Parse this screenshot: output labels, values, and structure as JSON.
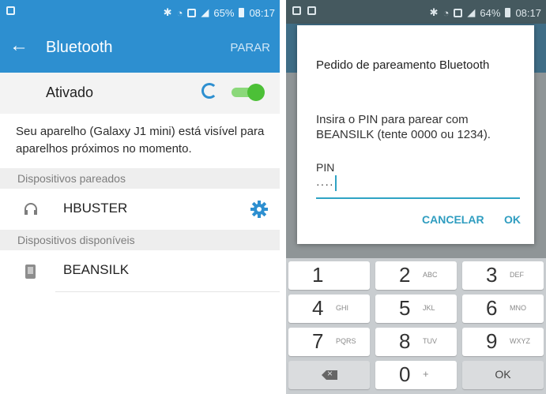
{
  "left": {
    "status": {
      "percent": "65%",
      "time": "08:17"
    },
    "title": "Bluetooth",
    "stop": "PARAR",
    "toggle_label": "Ativado",
    "info": "Seu aparelho (Galaxy J1 mini) está visível para aparelhos próximos no momento.",
    "paired_header": "Dispositivos pareados",
    "paired_devices": [
      {
        "name": "HBUSTER"
      }
    ],
    "available_header": "Dispositivos disponíveis",
    "available_devices": [
      {
        "name": "BEANSILK"
      }
    ],
    "colors": {
      "primary": "#2d8fd0",
      "switch_on": "#4cc037"
    }
  },
  "right": {
    "status": {
      "percent": "64%",
      "time": "08:17"
    },
    "dialog": {
      "title": "Pedido de pareamento Bluetooth",
      "message": "Insira o PIN para parear com BEANSILK (tente 0000 ou 1234).",
      "pin_label": "PIN",
      "pin_value": "····",
      "cancel": "CANCELAR",
      "ok": "OK"
    },
    "keypad": {
      "keys": [
        {
          "digit": "1",
          "letters": ""
        },
        {
          "digit": "2",
          "letters": "ABC"
        },
        {
          "digit": "3",
          "letters": "DEF"
        },
        {
          "digit": "4",
          "letters": "GHI"
        },
        {
          "digit": "5",
          "letters": "JKL"
        },
        {
          "digit": "6",
          "letters": "MNO"
        },
        {
          "digit": "7",
          "letters": "PQRS"
        },
        {
          "digit": "8",
          "letters": "TUV"
        },
        {
          "digit": "9",
          "letters": "WXYZ"
        }
      ],
      "zero": "0",
      "zero_sub": "+",
      "ok": "OK"
    },
    "colors": {
      "accent": "#2fa3c4"
    }
  }
}
